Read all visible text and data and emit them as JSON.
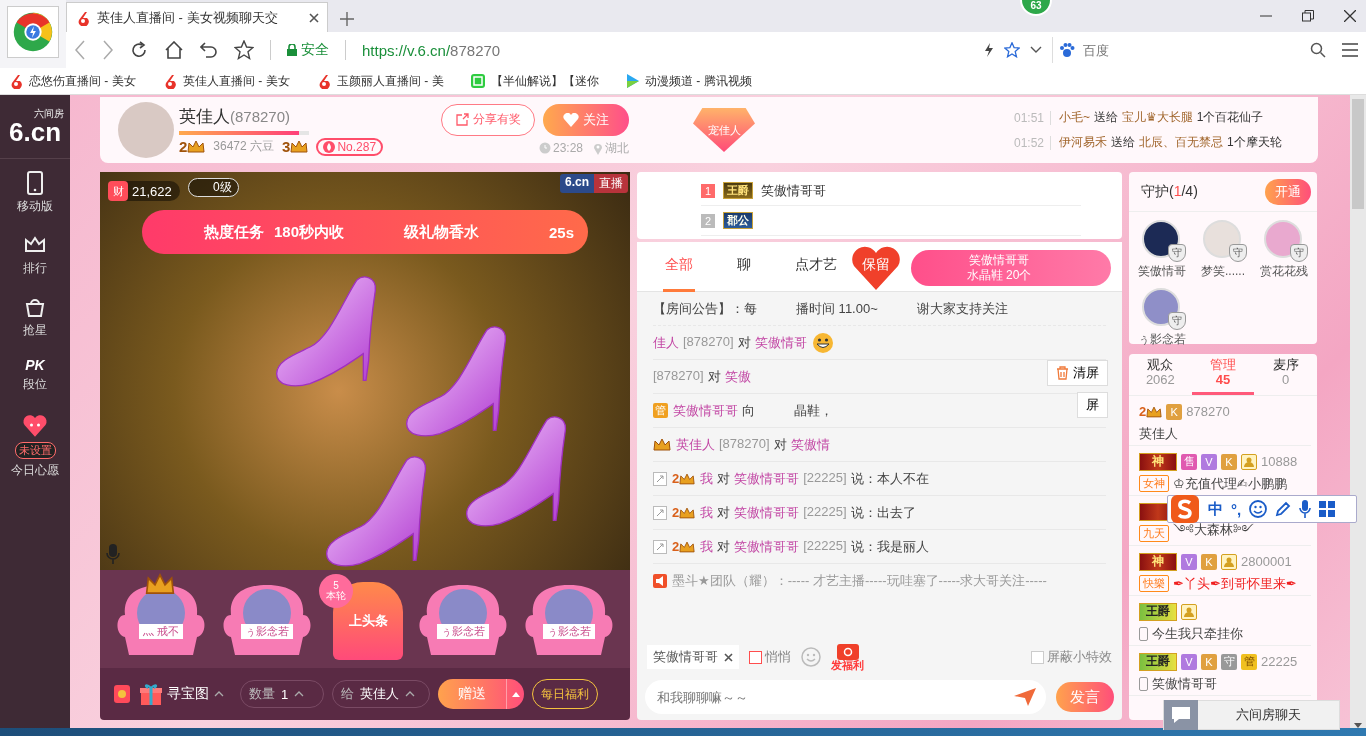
{
  "browser": {
    "tabs": [
      {
        "title": "英佳人直播间 - 美女视频聊天交",
        "selected": true
      }
    ],
    "badge_count": "63",
    "security_label": "安全",
    "url_host": "https://v.6.cn/",
    "url_path": "878270",
    "search_placeholder": "百度",
    "bookmarks": [
      {
        "title": "恋悠伤直播间 - 美女",
        "kind": "six"
      },
      {
        "title": "英佳人直播间 - 美女",
        "kind": "six"
      },
      {
        "title": "玉颜丽人直播间 - 美",
        "kind": "six"
      },
      {
        "title": "【半仙解说】【迷你",
        "kind": "video"
      },
      {
        "title": "动漫频道 - 腾讯视频",
        "kind": "play"
      }
    ]
  },
  "sidebar": {
    "logo": "6.cn",
    "logo_caption": "六间房",
    "items": [
      {
        "label": "移动版",
        "kind": "phone"
      },
      {
        "label": "排行",
        "kind": "crown"
      },
      {
        "label": "抢星",
        "kind": "bag"
      },
      {
        "label": "段位",
        "kind": "pk",
        "icon_text": "PK"
      },
      {
        "label": "今日心愿",
        "kind": "heart",
        "tag": "未设置"
      }
    ]
  },
  "header": {
    "name": "英佳人",
    "room_id": "(878270)",
    "level": 0.92,
    "anchor_level": "2",
    "beans": "36472 六豆",
    "wealth_level": "3",
    "rank": "No.287",
    "share": "分享有奖",
    "follow": "关注",
    "time": "23:28",
    "location": "湖北",
    "pet_badge": "宠佳人",
    "gift_feed": [
      {
        "time": "01:51",
        "sender": "小毛~",
        "verb": "送给",
        "receiver": "宝儿♛大长腿",
        "gift": "1个百花仙子"
      },
      {
        "time": "01:52",
        "sender": "伊河易禾",
        "verb": "送给",
        "receiver": "北辰、百无禁忌",
        "gift": "1个摩天轮"
      }
    ]
  },
  "video": {
    "wealth_icon": "财",
    "wealth": "21,622",
    "fan_level": "0级",
    "brand": "6.cn",
    "live": "直播",
    "task": [
      "热度任务",
      "180秒内收",
      "级礼物香水",
      "25s"
    ]
  },
  "seats": [
    {
      "kind": "seat",
      "name": "灬 戒不",
      "crowned": true
    },
    {
      "kind": "seat",
      "name": "ぅ影念若",
      "crowned": false
    },
    {
      "kind": "headline",
      "count": "5",
      "round": "本轮",
      "label": "上头条"
    },
    {
      "kind": "seat",
      "name": "ぅ影念若",
      "crowned": false
    },
    {
      "kind": "seat",
      "name": "ぅ影念若",
      "crowned": false
    }
  ],
  "gift_bar": {
    "gift": "寻宝图",
    "quantity_label": "数量",
    "quantity": "1",
    "to_label": "给",
    "to": "英佳人",
    "send": "赠送",
    "daily": "每日福利"
  },
  "chat": {
    "ranks": [
      {
        "rank": "1",
        "badge": "王爵",
        "name": "笑傲情哥哥"
      },
      {
        "rank": "2",
        "badge": "郡公"
      }
    ],
    "tabs": [
      {
        "label": "全部",
        "selected": true
      },
      {
        "label": "聊",
        "selected": false
      },
      {
        "label": "点才艺",
        "selected": false
      }
    ],
    "gift_popup": {
      "heart": "保留",
      "sender": "笑傲情哥哥",
      "gift": "水晶鞋 20个"
    },
    "messages": [
      {
        "kind": "notice",
        "parts": [
          {
            "text": "【房间公告】：每",
            "kind": "plain"
          }
        ],
        "after": [
          "播时间 11.00~",
          "谢大家支持关注"
        ]
      },
      {
        "kind": "user",
        "parts": [
          {
            "text": "佳人",
            "kind": "name"
          },
          {
            "text": "[878270]",
            "kind": "gray"
          },
          {
            "text": "对",
            "kind": "plain"
          },
          {
            "text": "笑傲情哥",
            "kind": "name"
          }
        ],
        "emoji": true
      },
      {
        "kind": "user",
        "parts": [
          {
            "text": "[878270]",
            "kind": "gray"
          },
          {
            "text": "对",
            "kind": "plain"
          },
          {
            "text": "笑傲",
            "kind": "name"
          }
        ],
        "emoji": false
      },
      {
        "kind": "user",
        "lead": [
          {
            "kind": "tag",
            "text": "管"
          }
        ],
        "parts": [
          {
            "text": "笑傲情哥哥",
            "kind": "name"
          },
          {
            "text": "向",
            "kind": "plain"
          }
        ],
        "after": [
          "晶鞋，"
        ],
        "emoji": false
      },
      {
        "kind": "user",
        "lead": [
          {
            "kind": "crown"
          }
        ],
        "parts": [
          {
            "text": "英佳人",
            "kind": "name"
          },
          {
            "text": "[878270]",
            "kind": "gray"
          },
          {
            "text": "对",
            "kind": "plain"
          },
          {
            "text": "笑傲情",
            "kind": "name"
          }
        ],
        "emoji": false
      },
      {
        "kind": "user",
        "lead": [
          {
            "kind": "expand"
          },
          {
            "kind": "level",
            "text": "2"
          }
        ],
        "parts": [
          {
            "text": "我",
            "kind": "name"
          },
          {
            "text": "对",
            "kind": "plain"
          },
          {
            "text": "笑傲情哥哥",
            "kind": "name"
          },
          {
            "text": "[22225]",
            "kind": "gray"
          },
          {
            "text": "说：本人不在",
            "kind": "plain"
          }
        ],
        "emoji": false
      },
      {
        "kind": "user",
        "lead": [
          {
            "kind": "expand"
          },
          {
            "kind": "level",
            "text": "2"
          }
        ],
        "parts": [
          {
            "text": "我",
            "kind": "name"
          },
          {
            "text": "对",
            "kind": "plain"
          },
          {
            "text": "笑傲情哥哥",
            "kind": "name"
          },
          {
            "text": "[22225]",
            "kind": "gray"
          },
          {
            "text": "说：出去了",
            "kind": "plain"
          }
        ],
        "emoji": false
      },
      {
        "kind": "user",
        "lead": [
          {
            "kind": "expand"
          },
          {
            "kind": "level",
            "text": "2"
          }
        ],
        "parts": [
          {
            "text": "我",
            "kind": "name"
          },
          {
            "text": "对",
            "kind": "plain"
          },
          {
            "text": "笑傲情哥哥",
            "kind": "name"
          },
          {
            "text": "[22225]",
            "kind": "gray"
          },
          {
            "text": "说：我是丽人",
            "kind": "plain"
          }
        ],
        "emoji": false
      },
      {
        "kind": "system",
        "lead": [
          {
            "kind": "speaker"
          }
        ],
        "parts": [
          {
            "text": "墨斗★团队（耀）：----- 才艺主播-----玩哇塞了-----求大哥关注-----",
            "kind": "gray"
          }
        ],
        "emoji": false
      }
    ],
    "screen_buttons": [
      "清屏",
      "屏"
    ],
    "input": {
      "recipient": "笑傲情哥哥",
      "private_label": "悄悄",
      "private_checked": false,
      "welfare": "发福利",
      "hide_effects": "屏蔽小特效",
      "hide_effects_checked": false,
      "placeholder": "和我聊聊嘛～～",
      "send": "发言"
    }
  },
  "guard": {
    "title": [
      {
        "text": "守护(",
        "kind": "plain"
      },
      {
        "text": "1",
        "kind": "red"
      },
      {
        "text": "/4)",
        "kind": "plain"
      }
    ],
    "open": "开通",
    "members": [
      {
        "name": "笑傲情哥",
        "badge": "守",
        "color": "#1c2a55"
      },
      {
        "name": "梦笑......",
        "badge": "守",
        "color": "#e8e0dc"
      },
      {
        "name": "赏花花残",
        "badge": "守",
        "color": "#e9a9cf"
      },
      {
        "name": "ぅ影念若",
        "badge": "守",
        "color": "#8f8fc8"
      }
    ]
  },
  "audience": {
    "tabs": [
      {
        "label": "观众",
        "count": "2062",
        "selected": false
      },
      {
        "label": "管理",
        "count": "45",
        "selected": true
      },
      {
        "label": "麦序",
        "count": "0",
        "selected": false
      }
    ],
    "users": [
      {
        "badges": [
          {
            "kind": "level",
            "text": "2"
          },
          {
            "kind": "k",
            "text": "K"
          }
        ],
        "id": "878270",
        "mobile": false,
        "name": {
          "text": "英佳人",
          "kind": "plain"
        }
      },
      {
        "rank": {
          "kind": "god",
          "text": "神"
        },
        "badges": [
          {
            "kind": "sell",
            "text": "售"
          },
          {
            "kind": "v",
            "text": "V"
          },
          {
            "kind": "k",
            "text": "K"
          },
          {
            "kind": "host"
          }
        ],
        "id": "10888",
        "tag": "女神",
        "mobile": false,
        "name": {
          "text": "♔充值代理✍小鹏鹏",
          "kind": "plain"
        }
      },
      {
        "rank": {
          "kind": "god"
        },
        "tag": "九天",
        "mobile": false,
        "name": {
          "text": "༺大森林༻",
          "kind": "plain"
        }
      },
      {
        "rank": {
          "kind": "god",
          "text": "神"
        },
        "badges": [
          {
            "kind": "v",
            "text": "V"
          },
          {
            "kind": "k",
            "text": "K"
          },
          {
            "kind": "host"
          }
        ],
        "id": "2800001",
        "tag": "快樂",
        "mobile": false,
        "name": {
          "text": "✒丫头✒到哥怀里来✒",
          "kind": "red"
        }
      },
      {
        "rank": {
          "kind": "duke",
          "text": "王爵"
        },
        "badges": [
          {
            "kind": "host"
          }
        ],
        "mobile": true,
        "name": {
          "text": "今生我只牵挂你",
          "kind": "plain"
        }
      },
      {
        "rank": {
          "kind": "duke",
          "text": "王爵"
        },
        "badges": [
          {
            "kind": "v",
            "text": "V"
          },
          {
            "kind": "k",
            "text": "K"
          },
          {
            "kind": "guard",
            "text": "守"
          },
          {
            "kind": "manage",
            "text": "管"
          }
        ],
        "id": "22225",
        "mobile": true,
        "name": {
          "text": "笑傲情哥哥",
          "kind": "plain"
        }
      }
    ]
  },
  "ime": {
    "mode": "中",
    "punct": "°,"
  },
  "chat_widget": {
    "label": "六间房聊天"
  }
}
